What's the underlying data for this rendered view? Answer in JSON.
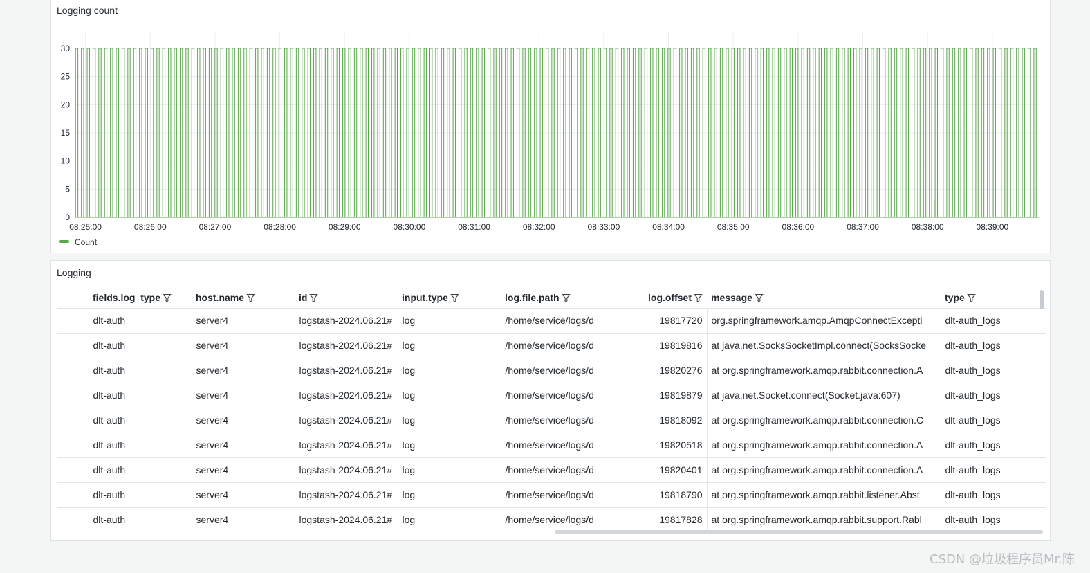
{
  "chart_panel": {
    "title": "Logging count"
  },
  "chart_data": {
    "type": "bar",
    "ylim": [
      0,
      30
    ],
    "yticks": [
      "0",
      "5",
      "10",
      "15",
      "20",
      "25",
      "30"
    ],
    "xticks": [
      "08:25:00",
      "08:26:00",
      "08:27:00",
      "08:28:00",
      "08:29:00",
      "08:30:00",
      "08:31:00",
      "08:32:00",
      "08:33:00",
      "08:34:00",
      "08:35:00",
      "08:36:00",
      "08:37:00",
      "08:38:00",
      "08:39:00"
    ],
    "x_start": "08:24:50",
    "x_end": "08:39:43",
    "series": [
      {
        "name": "Count",
        "color": "#5aa64b",
        "spike_value": 30,
        "spike_count": 166,
        "small_value": 3,
        "small_at": "08:38:06"
      }
    ],
    "grid": true,
    "legend_placement": "bottom-left"
  },
  "table_panel": {
    "title": "Logging",
    "columns": [
      "",
      "fields.log_type",
      "host.name",
      "id",
      "input.type",
      "log.file.path",
      "log.offset",
      "message",
      "type"
    ],
    "filter_icon": "filter-icon",
    "rows": [
      [
        "",
        "dlt-auth",
        "server4",
        "logstash-2024.06.21#",
        "log",
        "/home/service/logs/d",
        "19817720",
        "org.springframework.amqp.AmqpConnectExcepti",
        "dlt-auth_logs"
      ],
      [
        "",
        "dlt-auth",
        "server4",
        "logstash-2024.06.21#",
        "log",
        "/home/service/logs/d",
        "19819816",
        "at java.net.SocksSocketImpl.connect(SocksSocke",
        "dlt-auth_logs"
      ],
      [
        "",
        "dlt-auth",
        "server4",
        "logstash-2024.06.21#",
        "log",
        "/home/service/logs/d",
        "19820276",
        "at org.springframework.amqp.rabbit.connection.A",
        "dlt-auth_logs"
      ],
      [
        "",
        "dlt-auth",
        "server4",
        "logstash-2024.06.21#",
        "log",
        "/home/service/logs/d",
        "19819879",
        "at java.net.Socket.connect(Socket.java:607)",
        "dlt-auth_logs"
      ],
      [
        "",
        "dlt-auth",
        "server4",
        "logstash-2024.06.21#",
        "log",
        "/home/service/logs/d",
        "19818092",
        "at org.springframework.amqp.rabbit.connection.C",
        "dlt-auth_logs"
      ],
      [
        "",
        "dlt-auth",
        "server4",
        "logstash-2024.06.21#",
        "log",
        "/home/service/logs/d",
        "19820518",
        "at org.springframework.amqp.rabbit.connection.A",
        "dlt-auth_logs"
      ],
      [
        "",
        "dlt-auth",
        "server4",
        "logstash-2024.06.21#",
        "log",
        "/home/service/logs/d",
        "19820401",
        "at org.springframework.amqp.rabbit.connection.A",
        "dlt-auth_logs"
      ],
      [
        "",
        "dlt-auth",
        "server4",
        "logstash-2024.06.21#",
        "log",
        "/home/service/logs/d",
        "19818790",
        "at org.springframework.amqp.rabbit.listener.Abst",
        "dlt-auth_logs"
      ],
      [
        "",
        "dlt-auth",
        "server4",
        "logstash-2024.06.21#",
        "log",
        "/home/service/logs/d",
        "19817828",
        "at org.springframework.amqp.rabbit.support.Rabl",
        "dlt-auth_logs"
      ]
    ]
  },
  "watermark": "CSDN @垃圾程序员Mr.陈"
}
